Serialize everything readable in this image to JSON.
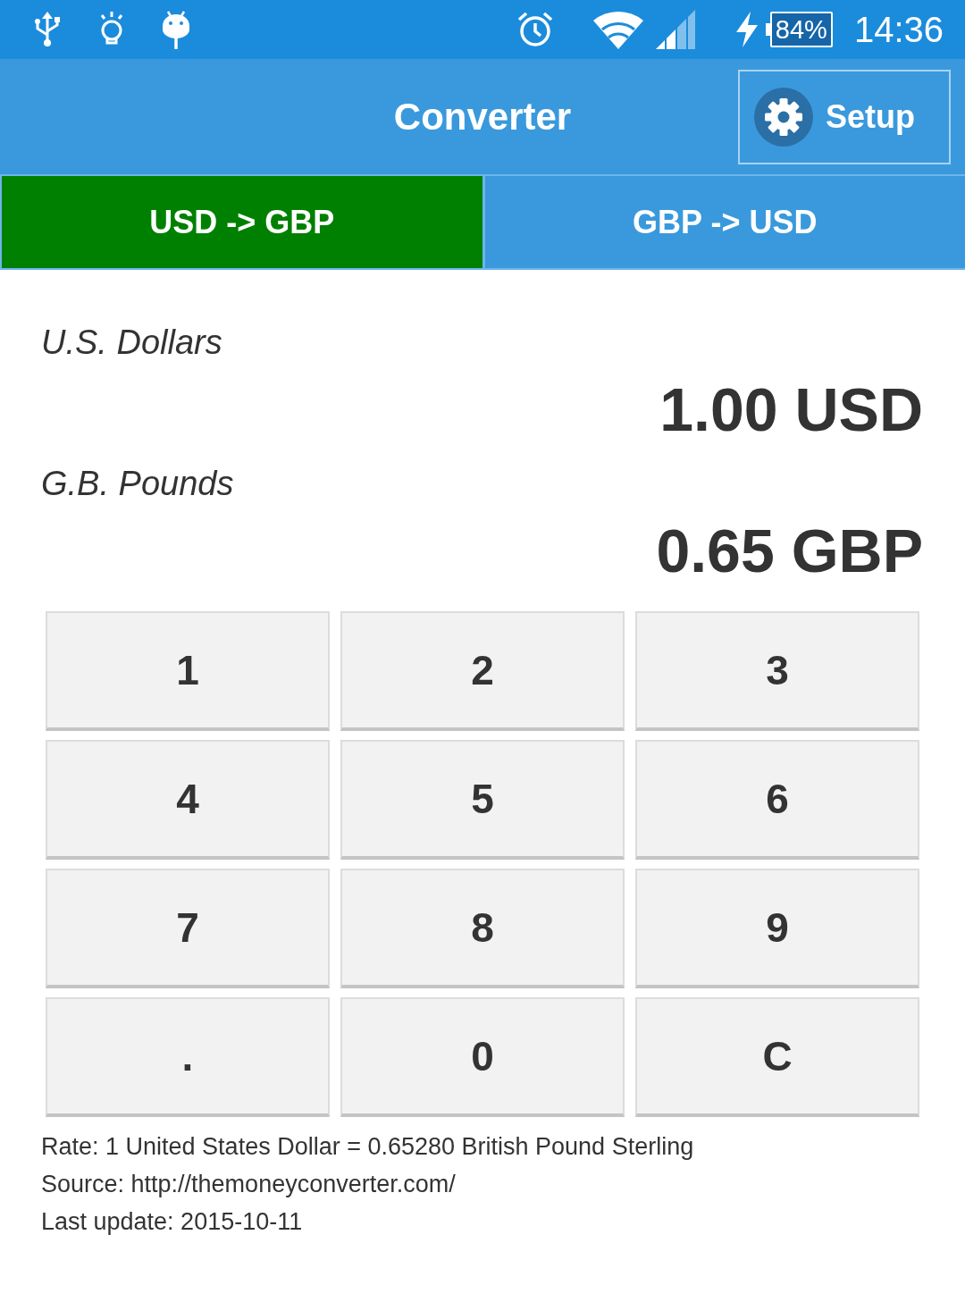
{
  "status_bar": {
    "battery": "84%",
    "time": "14:36"
  },
  "app_bar": {
    "title": "Converter",
    "setup_button": "Setup"
  },
  "tabs": [
    {
      "label": "USD -> GBP",
      "selected": true
    },
    {
      "label": "GBP -> USD",
      "selected": false
    }
  ],
  "conversion": [
    {
      "currency_name": "U.S. Dollars",
      "amount": "1.00 USD"
    },
    {
      "currency_name": "G.B. Pounds",
      "amount": "0.65 GBP"
    }
  ],
  "keypad": [
    "1",
    "2",
    "3",
    "4",
    "5",
    "6",
    "7",
    "8",
    "9",
    ".",
    "0",
    "C"
  ],
  "info_lines": [
    "Rate: 1 United States Dollar = 0.65280 British Pound Sterling",
    "Source: http://themoneyconverter.com/",
    "Last update: 2015-10-11"
  ]
}
